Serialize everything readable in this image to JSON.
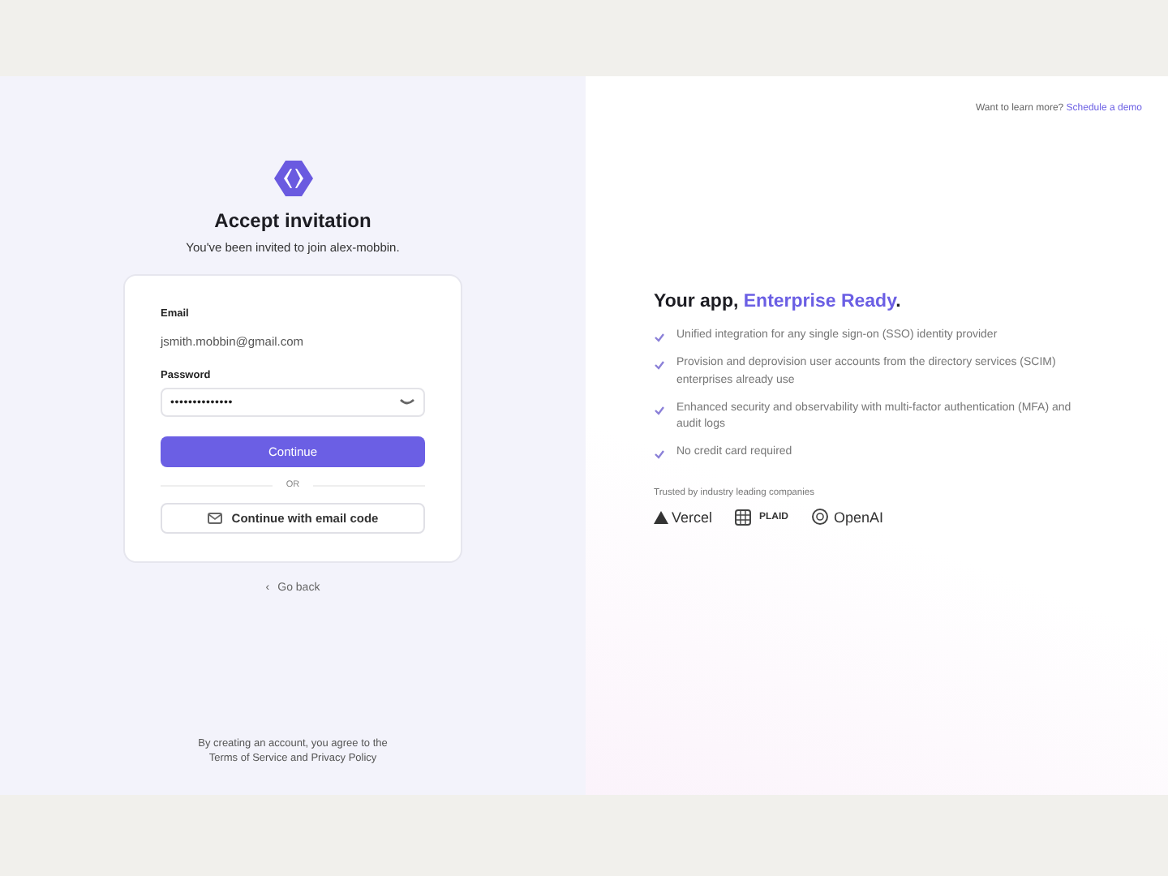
{
  "signin": {
    "title": "Accept invitation",
    "subtitle": "You've been invited to join alex-mobbin.",
    "email": {
      "label": "Email",
      "value": "jsmith.mobbin@gmail.com"
    },
    "password": {
      "label": "Password",
      "value": "••••••••••••••"
    },
    "continue_button": "Continue",
    "divider": "OR",
    "email_code_button": "Continue with email code",
    "back_link": "Go back",
    "back_caret": "‹",
    "legal": "By creating an account, you agree to the Terms of Service and Privacy Policy"
  },
  "promo": {
    "header_prompt": "Want to learn more?",
    "header_link": "Schedule a demo",
    "headline": [
      {
        "text": "Your app, ",
        "highlight": false
      },
      {
        "text": "Enterprise Ready",
        "highlight": true
      },
      {
        "text": ".",
        "highlight": false
      }
    ],
    "features": [
      {
        "text": "Unified integration for any single sign-on (SSO) identity provider",
        "checked": true
      },
      {
        "text": "Provision and deprovision user accounts from the directory services (SCIM) enterprises already use",
        "checked": true
      },
      {
        "text": "Enhanced security and observability with multi-factor authentication (MFA) and audit logs",
        "checked": true
      },
      {
        "text": "No credit card required",
        "checked": true
      }
    ],
    "trusted_label": "Trusted by industry leading companies",
    "companies": [
      {
        "kind": "triangle",
        "name": "Vercel"
      },
      {
        "kind": "grid",
        "name": "PLAID"
      },
      {
        "kind": "knot",
        "name": "OpenAI"
      }
    ]
  }
}
